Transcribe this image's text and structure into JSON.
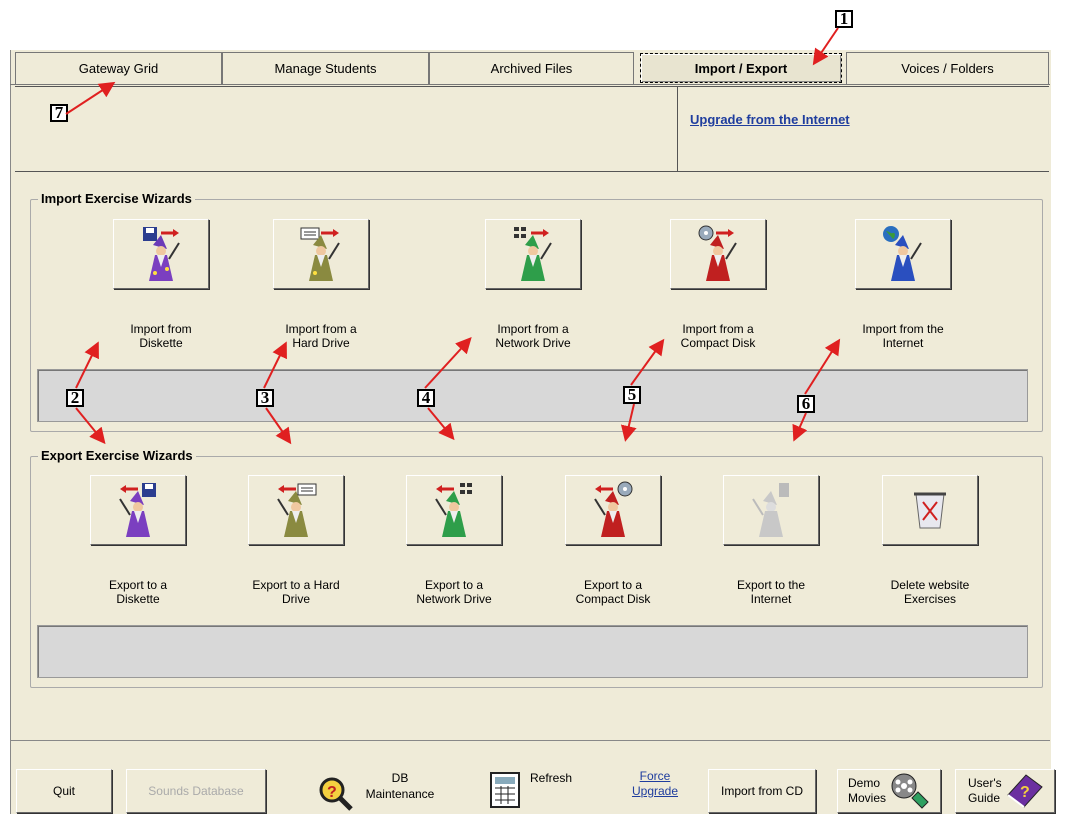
{
  "tabs": [
    "Gateway Grid",
    "Manage Students",
    "Archived Files",
    "Import / Export",
    "Voices / Folders"
  ],
  "upgrade_link": "Upgrade from the Internet",
  "import_group": {
    "title": "Import Exercise Wizards",
    "items": [
      {
        "label": "Import from\nDiskette",
        "icon": "wizard-diskette-icon"
      },
      {
        "label": "Import from a\nHard Drive",
        "icon": "wizard-harddrive-icon"
      },
      {
        "label": "Import from a\nNetwork Drive",
        "icon": "wizard-network-icon"
      },
      {
        "label": "Import from a\nCompact Disk",
        "icon": "wizard-cd-icon"
      },
      {
        "label": "Import from the\nInternet",
        "icon": "wizard-globe-icon"
      }
    ]
  },
  "export_group": {
    "title": "Export Exercise Wizards",
    "items": [
      {
        "label": "Export to a\nDiskette",
        "icon": "wizard-diskette-icon"
      },
      {
        "label": "Export to a Hard\nDrive",
        "icon": "wizard-harddrive-icon"
      },
      {
        "label": "Export to a\nNetwork Drive",
        "icon": "wizard-network-icon"
      },
      {
        "label": "Export to a\nCompact Disk",
        "icon": "wizard-cd-icon"
      },
      {
        "label": "Export to the\nInternet",
        "icon": "wizard-internet-disabled-icon"
      },
      {
        "label": "Delete website\nExercises",
        "icon": "trash-can-icon"
      }
    ]
  },
  "bottom": {
    "quit": "Quit",
    "sounds_db": "Sounds Database",
    "db_maint": "DB\nMaintenance",
    "refresh": "Refresh",
    "force_upgrade": "Force\nUpgrade",
    "import_cd": "Import from CD",
    "demo_movies": "Demo\nMovies",
    "users_guide": "User's\nGuide"
  },
  "callouts": [
    "1",
    "2",
    "3",
    "4",
    "5",
    "6",
    "7"
  ],
  "colors": {
    "panel": "#efebd8",
    "link": "#1f3d9e",
    "arrow": "#e02020",
    "status": "#d8d8d8"
  }
}
